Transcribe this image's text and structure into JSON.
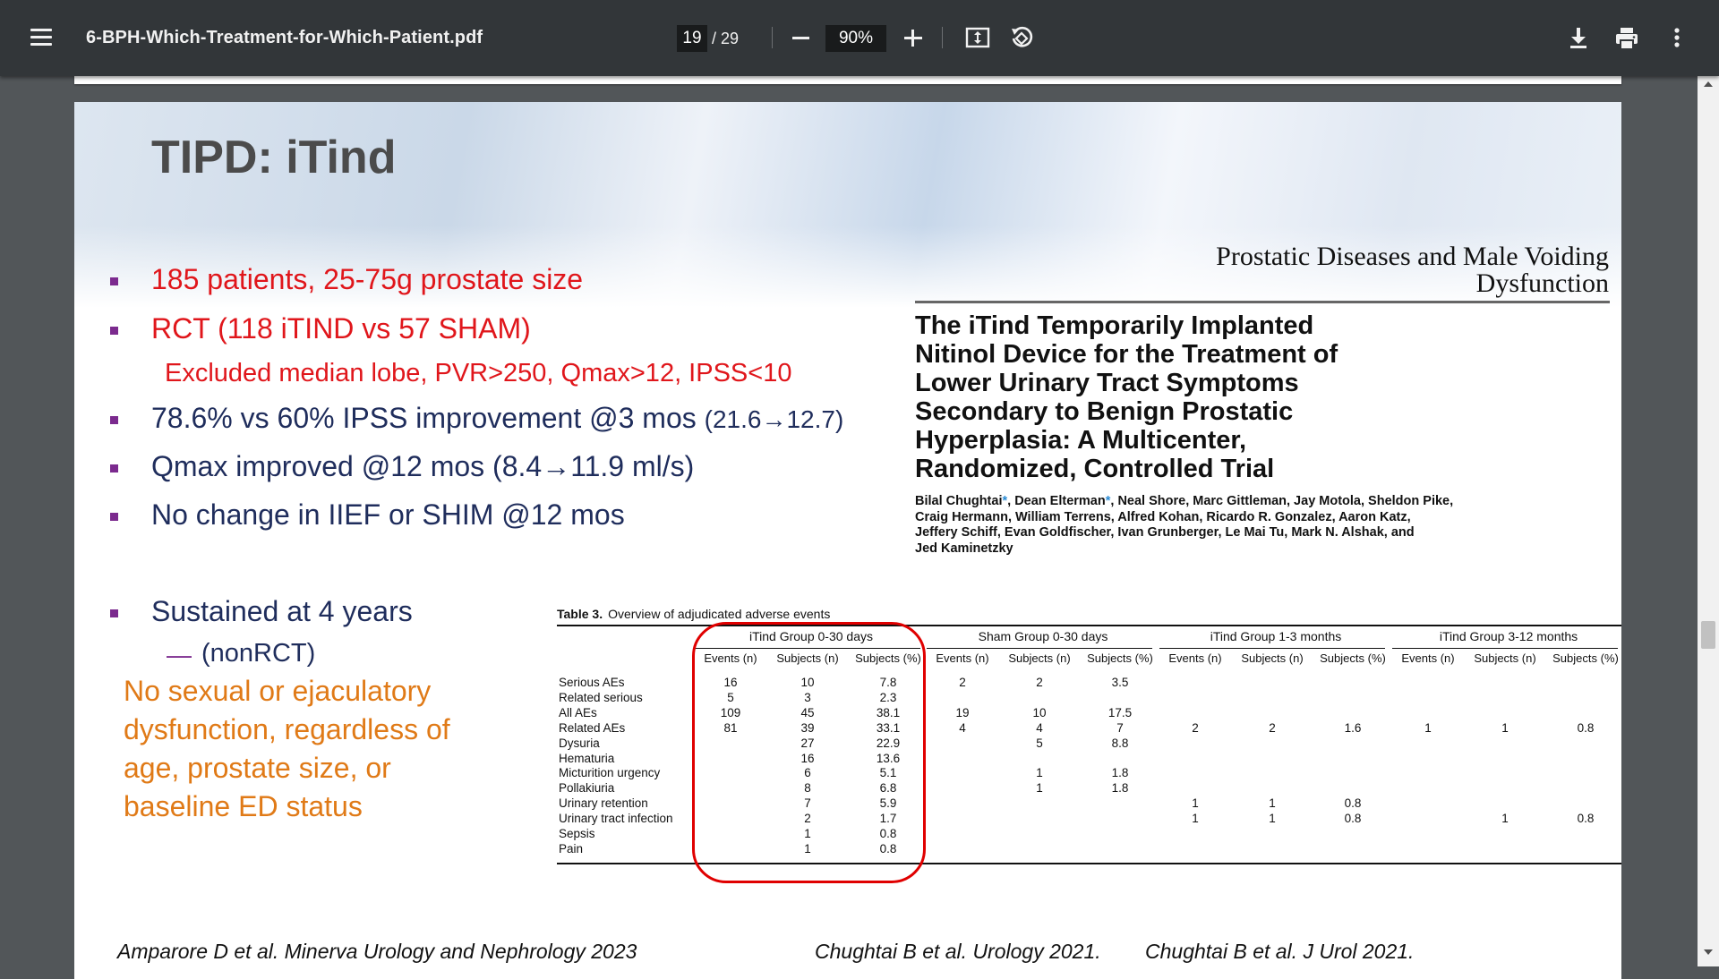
{
  "toolbar": {
    "filename": "6-BPH-Which-Treatment-for-Which-Patient.pdf",
    "current_page": "19",
    "total_pages": "/ 29",
    "zoom": "90%",
    "icons": [
      "menu-icon",
      "zoom-out-icon",
      "zoom-in-icon",
      "fit-page-icon",
      "rotate-icon",
      "download-icon",
      "print-icon",
      "more-vertical-icon"
    ]
  },
  "slide": {
    "title": "TIPD: iTind",
    "bullets": [
      "185 patients, 25-75g prostate size",
      "RCT (118 iTIND vs 57 SHAM)",
      "78.6% vs 60% IPSS improvement @3 mos",
      "Qmax improved @12 mos (8.4→11.9 ml/s)",
      "No change in IIEF or SHIM @12 mos",
      "Sustained at 4 years"
    ],
    "ipss_detail": "(21.6→12.7)",
    "sub_excluded": "Excluded median lobe, PVR>250, Qmax>12, IPSS<10",
    "sub_nonrct_dash": "—",
    "sub_nonrct": "(nonRCT)",
    "orange_note": [
      "No sexual or ejaculatory",
      "dysfunction, regardless of",
      "age, prostate size, or",
      "baseline ED status"
    ],
    "bullet_color": "#7b2a8e",
    "red_color": "#e0161b",
    "navy_color": "#1f2d5c",
    "orange_color": "#e07a17"
  },
  "article": {
    "journal": [
      "Prostatic Diseases and Male Voiding",
      "Dysfunction"
    ],
    "title": [
      "The iTind Temporarily Implanted",
      "Nitinol Device for the Treatment of",
      "Lower Urinary Tract Symptoms",
      "Secondary to Benign Prostatic",
      "Hyperplasia: A Multicenter,",
      "Randomized, Controlled Trial"
    ],
    "authors": {
      "a1": "Bilal Chughtai",
      "star": "*",
      "a2": ", Dean Elterman",
      "a3": ", Neal Shore, Marc Gittleman, Jay Motola, Sheldon Pike,",
      "line2": "Craig Hermann, William Terrens, Alfred Kohan, Ricardo R. Gonzalez, Aaron Katz,",
      "line3": "Jeffery Schiff, Evan Goldfischer, Ivan Grunberger, Le Mai Tu, Mark N. Alshak, and",
      "line4": "Jed Kaminetzky"
    }
  },
  "table": {
    "label": "Table 3.",
    "caption": "Overview of adjudicated adverse events",
    "groups": [
      "iTind Group 0-30 days",
      "Sham Group 0-30 days",
      "iTind Group 1-3 months",
      "iTind Group 3-12 months"
    ],
    "subheaders": [
      "Events (n)",
      "Subjects (n)",
      "Subjects (%)"
    ],
    "rows": [
      {
        "label": "Serious AEs",
        "cells": [
          "16",
          "10",
          "7.8",
          "2",
          "2",
          "3.5",
          "",
          "",
          "",
          "",
          "",
          ""
        ]
      },
      {
        "label": "Related serious",
        "cells": [
          "5",
          "3",
          "2.3",
          "",
          "",
          "",
          "",
          "",
          "",
          "",
          "",
          ""
        ]
      },
      {
        "label": "All AEs",
        "cells": [
          "109",
          "45",
          "38.1",
          "19",
          "10",
          "17.5",
          "",
          "",
          "",
          "",
          "",
          ""
        ]
      },
      {
        "label": "Related AEs",
        "cells": [
          "81",
          "39",
          "33.1",
          "4",
          "4",
          "7",
          "2",
          "2",
          "1.6",
          "1",
          "1",
          "0.8"
        ]
      },
      {
        "label": "Dysuria",
        "cells": [
          "",
          "27",
          "22.9",
          "",
          "5",
          "8.8",
          "",
          "",
          "",
          "",
          "",
          ""
        ]
      },
      {
        "label": "Hematuria",
        "cells": [
          "",
          "16",
          "13.6",
          "",
          "",
          "",
          "",
          "",
          "",
          "",
          "",
          ""
        ]
      },
      {
        "label": "Micturition urgency",
        "cells": [
          "",
          "6",
          "5.1",
          "",
          "1",
          "1.8",
          "",
          "",
          "",
          "",
          "",
          ""
        ]
      },
      {
        "label": "Pollakiuria",
        "cells": [
          "",
          "8",
          "6.8",
          "",
          "1",
          "1.8",
          "",
          "",
          "",
          "",
          "",
          ""
        ]
      },
      {
        "label": "Urinary retention",
        "cells": [
          "",
          "7",
          "5.9",
          "",
          "",
          "",
          "1",
          "1",
          "0.8",
          "",
          "",
          ""
        ]
      },
      {
        "label": "Urinary tract infection",
        "cells": [
          "",
          "2",
          "1.7",
          "",
          "",
          "",
          "1",
          "1",
          "0.8",
          "",
          "1",
          "0.8"
        ]
      },
      {
        "label": "Sepsis",
        "cells": [
          "",
          "1",
          "0.8",
          "",
          "",
          "",
          "",
          "",
          "",
          "",
          "",
          ""
        ]
      },
      {
        "label": "Pain",
        "cells": [
          "",
          "1",
          "0.8",
          "",
          "",
          "",
          "",
          "",
          "",
          "",
          "",
          ""
        ]
      }
    ],
    "highlight_color": "#e00000"
  },
  "citations": [
    "Amparore D et al. Minerva Urology and Nephrology 2023",
    "Chughtai B et al. Urology 2021.",
    "Chughtai B et al. J Urol 2021."
  ]
}
